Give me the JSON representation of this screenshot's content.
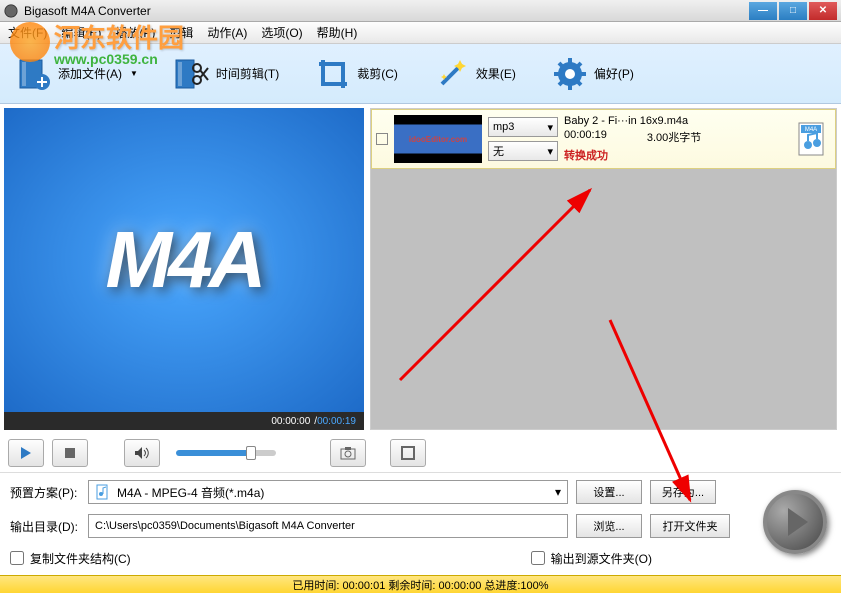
{
  "window": {
    "title": "Bigasoft M4A Converter"
  },
  "watermark": {
    "line1": "河东软件园",
    "line2": "www.pc0359.cn"
  },
  "menu": {
    "file": "文件(F)",
    "edit": "编辑(E)",
    "play": "播放(P)",
    "trim": "剪辑",
    "action": "动作(A)",
    "options": "选项(O)",
    "help": "帮助(H)"
  },
  "toolbar": {
    "addFile": "添加文件(A)",
    "trim": "时间剪辑(T)",
    "crop": "裁剪(C)",
    "effect": "效果(E)",
    "pref": "偏好(P)"
  },
  "preview": {
    "logo": "M4A",
    "currentTime": "00:00:00",
    "totalTime": "00:00:19"
  },
  "fileList": {
    "items": [
      {
        "thumbText": "idooEditor.com",
        "format": "mp3",
        "secondary": "无",
        "filename": "Baby 2 - Fi···in 16x9.m4a",
        "duration": "00:00:19",
        "size": "3.00兆字节",
        "status": "转换成功",
        "iconLabel": "M4A"
      }
    ]
  },
  "bottom": {
    "profileLabel": "预置方案(P):",
    "profileValue": "M4A - MPEG-4 音频(*.m4a)",
    "settingsBtn": "设置...",
    "saveAsBtn": "另存为...",
    "outputLabel": "输出目录(D):",
    "outputPath": "C:\\Users\\pc0359\\Documents\\Bigasoft M4A Converter",
    "browseBtn": "浏览...",
    "openFolderBtn": "打开文件夹",
    "copyStructure": "复制文件夹结构(C)",
    "outputToSource": "输出到源文件夹(O)"
  },
  "progress": {
    "text": "已用时间: 00:00:01 剩余时间: 00:00:00 总进度:100%"
  }
}
